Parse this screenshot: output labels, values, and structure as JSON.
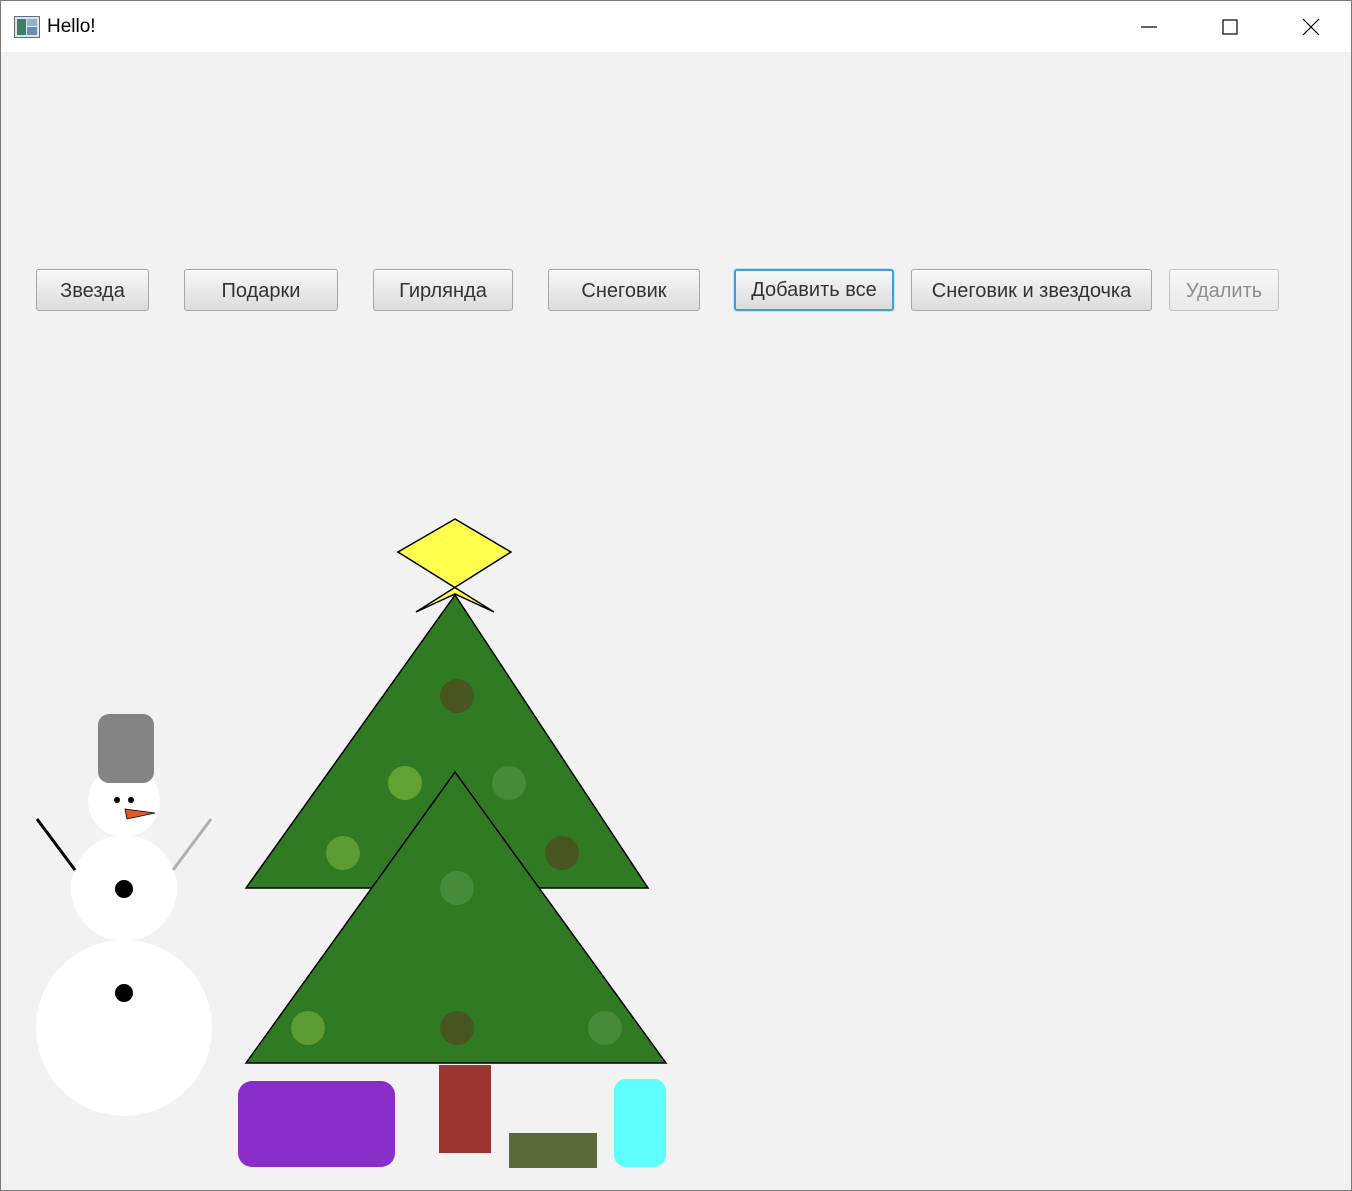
{
  "window": {
    "title": "Hello!"
  },
  "toolbar": {
    "buttons": [
      {
        "id": "star",
        "label": "Звезда",
        "state": "normal"
      },
      {
        "id": "gifts",
        "label": "Подарки",
        "state": "normal"
      },
      {
        "id": "garland",
        "label": "Гирлянда",
        "state": "normal"
      },
      {
        "id": "snowman",
        "label": "Снеговик",
        "state": "normal"
      },
      {
        "id": "add-all",
        "label": "Добавить все",
        "state": "focused"
      },
      {
        "id": "snowman-star",
        "label": "Снеговик и звездочка",
        "state": "normal"
      },
      {
        "id": "delete",
        "label": "Удалить",
        "state": "disabled"
      }
    ]
  },
  "colors": {
    "background": "#f2f2f2",
    "tree": "#317a24",
    "star": "#ffff4d",
    "trunk": "#9b3530",
    "gift_purple": "#8a2ec9",
    "gift_olive": "#5a6a3a",
    "gift_cyan": "#5ffffd",
    "snow": "#ffffff",
    "hat": "#848484",
    "nose": "#e05a2a",
    "focus": "#3d9ee0"
  }
}
